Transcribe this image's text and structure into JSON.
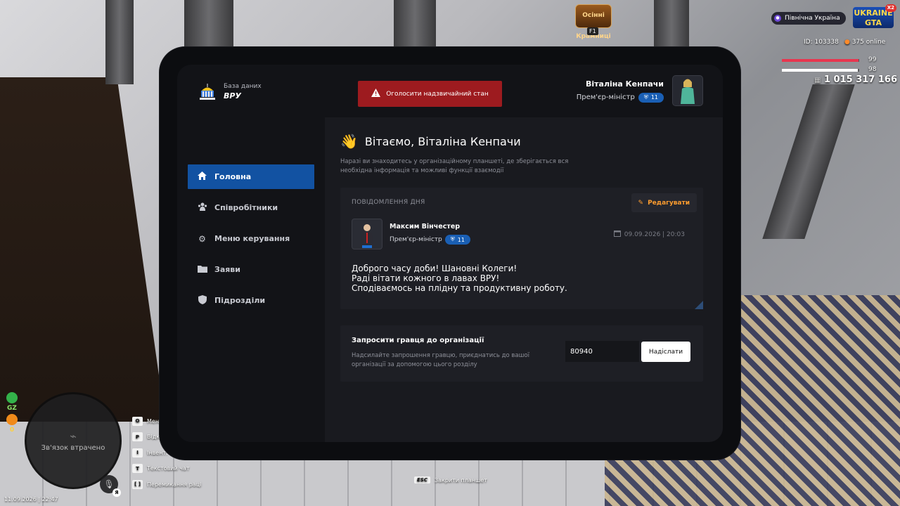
{
  "hud": {
    "event_logo": "Осінні Крамниці",
    "event_key": "F1",
    "region": "Північна Україна",
    "brand": "UKRAINE GTA",
    "brand_badge": "X2",
    "player_id": "ID: 103338",
    "online": "375 online",
    "health": "99",
    "health_fraction": 0.99,
    "armor": "98",
    "armor_fraction": 0.98,
    "money": "1 015 317 166",
    "radar_text": "Зв'язок втрачено",
    "gz_label": "GZ",
    "gz_value": "0",
    "voice_key": "Я",
    "datetime": "11.09.2026 | 22:47",
    "keybinds": [
      {
        "key": "O",
        "label": "Мені"
      },
      {
        "key": "P",
        "label": "Відк"
      },
      {
        "key": "I",
        "label": "Інвент."
      },
      {
        "key": "T",
        "label": "Текстовий чат"
      },
      {
        "key": "[ ]",
        "label": "Перемикання раці"
      }
    ],
    "esc_key": "ESC",
    "esc_label": "Закрити планшет"
  },
  "tablet": {
    "org_subtitle": "База даних",
    "org_name": "ВРУ",
    "alarm_label": "Оголосити надзвичайний стан",
    "user": {
      "name": "Віталіна Кенпачи",
      "role": "Прем'єр-міністр",
      "rank": "11"
    },
    "nav": [
      {
        "label": "Головна",
        "icon": "home-icon"
      },
      {
        "label": "Співробітники",
        "icon": "users-icon"
      },
      {
        "label": "Меню керування",
        "icon": "gear-icon"
      },
      {
        "label": "Заяви",
        "icon": "folder-icon"
      },
      {
        "label": "Підрозділи",
        "icon": "shield-icon"
      }
    ],
    "greeting": "Вітаємо, Віталіна Кенпачи",
    "intro": "Наразі ви знаходитесь у організаційному планшеті, де зберігається вся необхідна інформація та можливі функції взаємодії",
    "motd": {
      "title": "ПОВІДОМЛЕННЯ ДНЯ",
      "edit_label": "Редагувати",
      "author_name": "Максим Вінчестер",
      "author_role": "Прем'єр-міністр",
      "author_rank": "11",
      "date": "09.09.2026 | 20:03",
      "lines": [
        "Доброго часу доби! Шановні Колеги!",
        "Раді вітати кожного в лавах ВРУ!",
        "Сподіваємось на плідну та продуктивну роботу."
      ]
    },
    "invite": {
      "title": "Запросити гравця до організації",
      "description": "Надсилайте запрошення гравцю, приєднатись до вашої організації за допомогою цього розділу",
      "input_value": "80940",
      "send_label": "Надіслати"
    }
  }
}
